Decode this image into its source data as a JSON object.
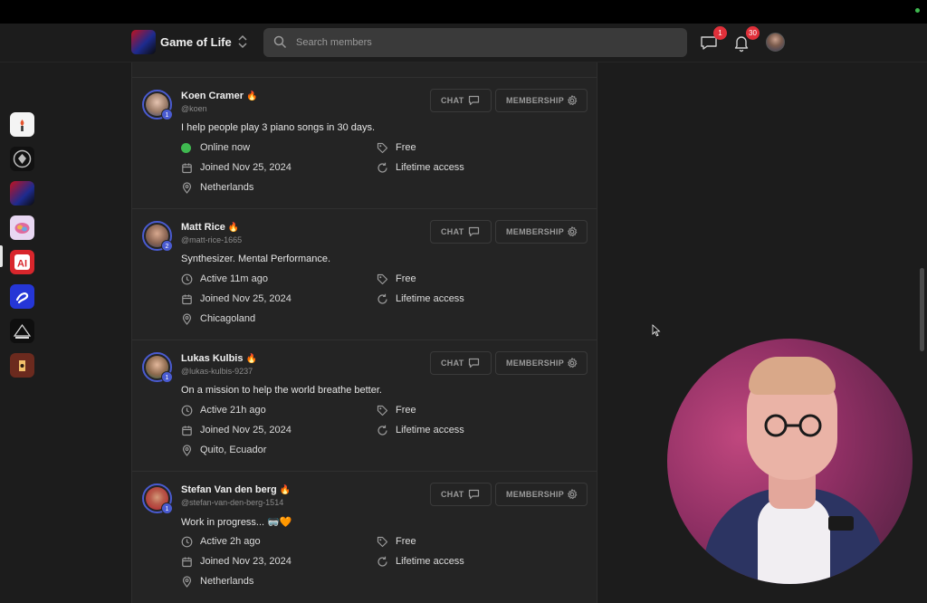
{
  "header": {
    "app_title": "Game of Life",
    "search_placeholder": "Search members",
    "chat_badge": "1",
    "notifications_badge": "30"
  },
  "rail": {
    "items": [
      "torch-community-icon",
      "helmet-community-icon",
      "game-of-life-icon",
      "brain-community-icon",
      "ai-community-icon",
      "swirl-community-icon",
      "greatness-community-icon",
      "doorway-community-icon"
    ]
  },
  "buttons": {
    "chat": "CHAT",
    "membership": "MEMBERSHIP"
  },
  "members": [
    {
      "name": "Koen Cramer",
      "handle": "@koen",
      "level": "1",
      "bio": "I help people play 3 piano songs in 30 days.",
      "activity": "Online now",
      "online": true,
      "price": "Free",
      "joined": "Joined Nov 25, 2024",
      "access": "Lifetime access",
      "location": "Netherlands"
    },
    {
      "name": "Matt Rice",
      "handle": "@matt-rice-1665",
      "level": "2",
      "bio": "Synthesizer. Mental Performance.",
      "activity": "Active 11m ago",
      "online": false,
      "price": "Free",
      "joined": "Joined Nov 25, 2024",
      "access": "Lifetime access",
      "location": "Chicagoland"
    },
    {
      "name": "Lukas Kulbis",
      "handle": "@lukas-kulbis-9237",
      "level": "1",
      "bio": "On a mission to help the world breathe better.",
      "activity": "Active 21h ago",
      "online": false,
      "price": "Free",
      "joined": "Joined Nov 25, 2024",
      "access": "Lifetime access",
      "location": "Quito, Ecuador"
    },
    {
      "name": "Stefan Van den berg",
      "handle": "@stefan-van-den-berg-1514",
      "level": "1",
      "bio": "Work in progress... 🥽🧡",
      "activity": "Active 2h ago",
      "online": false,
      "price": "Free",
      "joined": "Joined Nov 23, 2024",
      "access": "Lifetime access",
      "location": "Netherlands"
    }
  ],
  "colors": {
    "accent": "#4a5bd1",
    "online": "#3fb950",
    "badge": "#e0303a"
  }
}
